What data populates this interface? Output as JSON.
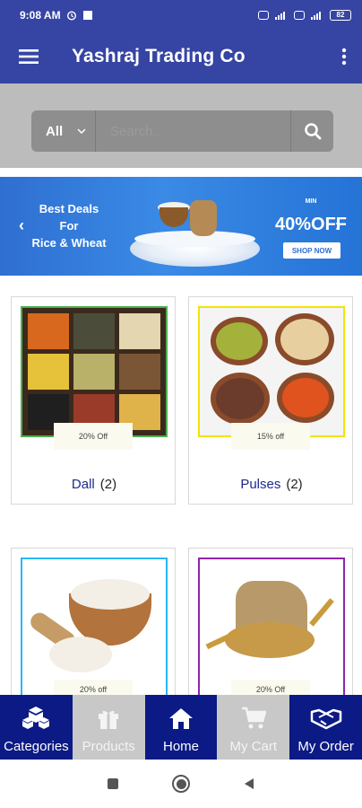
{
  "status": {
    "time": "9:08 AM",
    "battery": "82"
  },
  "app_bar": {
    "title": "Yashraj Trading Co"
  },
  "search": {
    "category_selected": "All",
    "placeholder": "Search.."
  },
  "banner": {
    "headline_line1": "Best Deals",
    "headline_line2": "For",
    "headline_line3": "Rice & Wheat",
    "min_label": "MIN",
    "discount": "40%",
    "off_label": "OFF",
    "cta": "SHOP NOW"
  },
  "categories": [
    {
      "name": "Dall",
      "count": "(2)",
      "discount": "20% Off",
      "frame_color": "#4caf50"
    },
    {
      "name": "Pulses",
      "count": "(2)",
      "discount": "15% off",
      "frame_color": "#f2e300"
    },
    {
      "name": "",
      "count": "",
      "discount": "20% off",
      "frame_color": "#29b6f6"
    },
    {
      "name": "",
      "count": "",
      "discount": "20% Off",
      "frame_color": "#8e24aa"
    }
  ],
  "bottom_nav": {
    "items": [
      {
        "label": "Categories",
        "icon": "cubes-icon",
        "active": false
      },
      {
        "label": "Products",
        "icon": "gift-icon",
        "active": false
      },
      {
        "label": "Home",
        "icon": "home-icon",
        "active": true
      },
      {
        "label": "My Cart",
        "icon": "cart-icon",
        "active": false
      },
      {
        "label": "My Order",
        "icon": "handshake-icon",
        "active": false
      }
    ]
  },
  "colors": {
    "primary": "#3645a3",
    "nav_dark": "#0b1a85",
    "nav_light": "#c8c8c8"
  }
}
